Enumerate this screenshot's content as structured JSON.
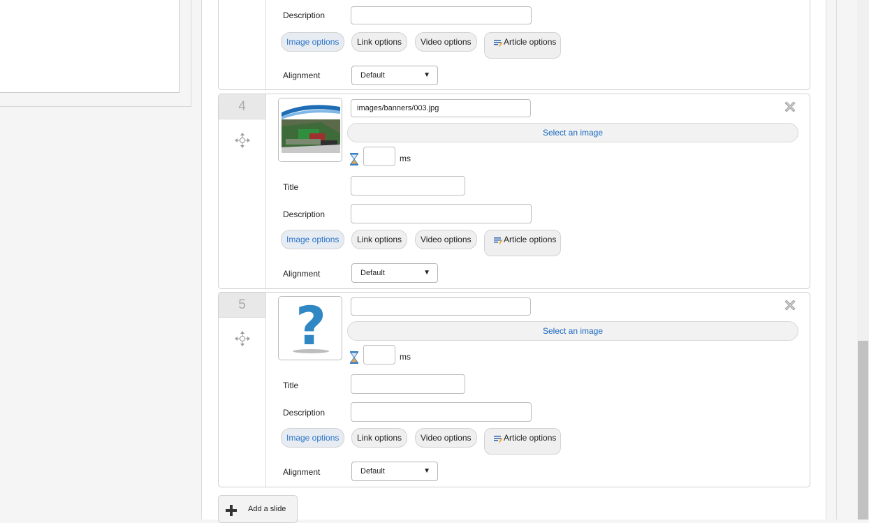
{
  "labels": {
    "title": "Title",
    "description": "Description",
    "alignment": "Alignment",
    "ms": "ms",
    "select_image": "Select an image"
  },
  "option_buttons": {
    "image": "Image options",
    "link": "Link options",
    "video": "Video options",
    "article": "Article options"
  },
  "slide3_partial": {
    "description_value": "",
    "alignment_value": "Default"
  },
  "slides": [
    {
      "number": "4",
      "image_path": "images/banners/003.jpg",
      "duration": "",
      "title_value": "",
      "description_value": "",
      "alignment_value": "Default",
      "thumbnail": "banner-image-thumbnail"
    },
    {
      "number": "5",
      "image_path": "",
      "duration": "",
      "title_value": "",
      "description_value": "",
      "alignment_value": "Default",
      "thumbnail": "question-mark-placeholder"
    }
  ],
  "add_slide": {
    "label": "Add a slide"
  },
  "icons": {
    "move": "move-arrows-icon",
    "close": "close-x-icon",
    "hourglass": "hourglass-icon",
    "article": "article-pencil-icon",
    "add": "plus-icon"
  },
  "colors": {
    "link_blue": "#1565c0",
    "active_tab_blue": "#2b73c6",
    "question_blue": "#2f87c4"
  }
}
